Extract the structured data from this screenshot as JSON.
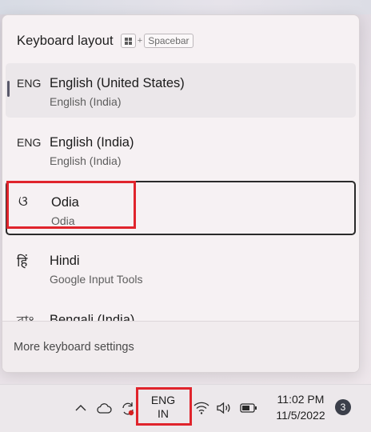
{
  "flyout": {
    "title": "Keyboard layout",
    "shortcut": {
      "plus": "+",
      "key": "Spacebar"
    },
    "layouts": [
      {
        "abbr": "ENG",
        "name": "English (United States)",
        "sub": "English (India)",
        "selected": true
      },
      {
        "abbr": "ENG",
        "name": "English (India)",
        "sub": "English (India)"
      },
      {
        "abbr": "ଓ",
        "name": "Odia",
        "sub": "Odia",
        "focused": true
      },
      {
        "abbr": "हिं",
        "name": "Hindi",
        "sub": "Google Input Tools"
      },
      {
        "abbr": "বাং",
        "name": "Bengali (India)",
        "sub": ""
      }
    ],
    "footer_link": "More keyboard settings"
  },
  "taskbar": {
    "input_indicator": {
      "line1": "ENG",
      "line2": "IN"
    },
    "clock": {
      "time": "11:02 PM",
      "date": "11/5/2022"
    },
    "notification_count": "3",
    "icons": [
      "chevron-up-icon",
      "cloud-icon",
      "sync-icon",
      "wifi-icon",
      "volume-icon",
      "battery-icon"
    ]
  },
  "colors": {
    "highlight": "#e0242c",
    "focus_border": "#2a2a2a",
    "badge": "#3b3f4a"
  }
}
